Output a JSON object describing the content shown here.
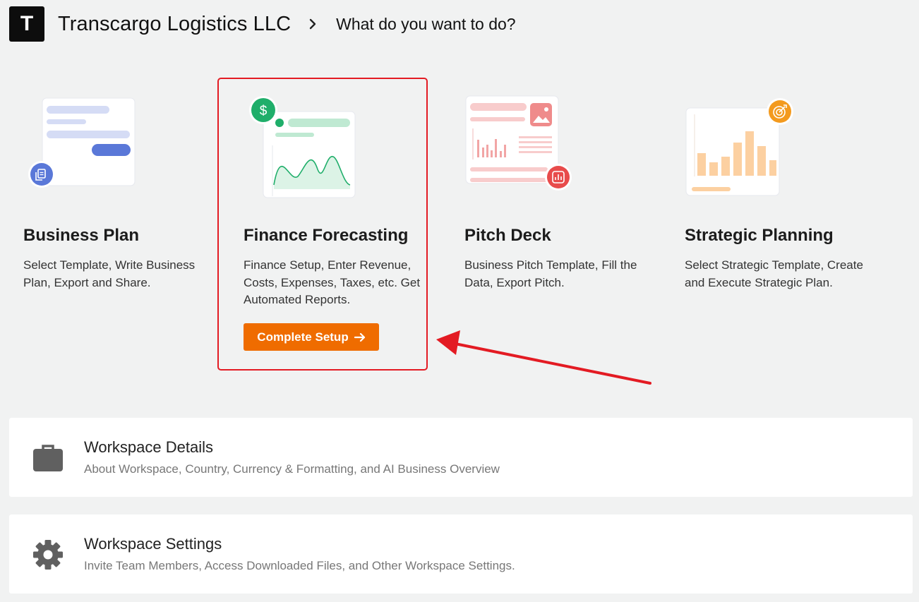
{
  "header": {
    "logo_letter": "T",
    "company_name": "Transcargo Logistics LLC",
    "page_title": "What do you want to do?"
  },
  "cards": [
    {
      "title": "Business Plan",
      "description": "Select Template, Write Business Plan, Export and Share.",
      "badge_icon": "document-icon",
      "badge_color": "#5a78d8"
    },
    {
      "title": "Finance Forecasting",
      "description": "Finance Setup, Enter Revenue, Costs, Expenses, Taxes, etc. Get Automated Reports.",
      "badge_icon": "dollar-icon",
      "badge_color": "#1fae6a",
      "button_label": "Complete Setup",
      "button_color": "#ef6c00"
    },
    {
      "title": "Pitch Deck",
      "description": "Business Pitch Template, Fill the Data, Export Pitch.",
      "badge_icon": "chart-icon",
      "badge_color": "#e84b4b"
    },
    {
      "title": "Strategic Planning",
      "description": "Select Strategic Template, Create and Execute Strategic Plan.",
      "badge_icon": "target-icon",
      "badge_color": "#f39a1e"
    }
  ],
  "workspace": [
    {
      "title": "Workspace Details",
      "subtitle": "About Workspace, Country, Currency & Formatting, and AI Business Overview",
      "icon": "briefcase-icon"
    },
    {
      "title": "Workspace Settings",
      "subtitle": "Invite Team Members, Access Downloaded Files, and Other Workspace Settings.",
      "icon": "gear-icon"
    }
  ],
  "annotation": {
    "highlight_color": "#e31b23"
  }
}
